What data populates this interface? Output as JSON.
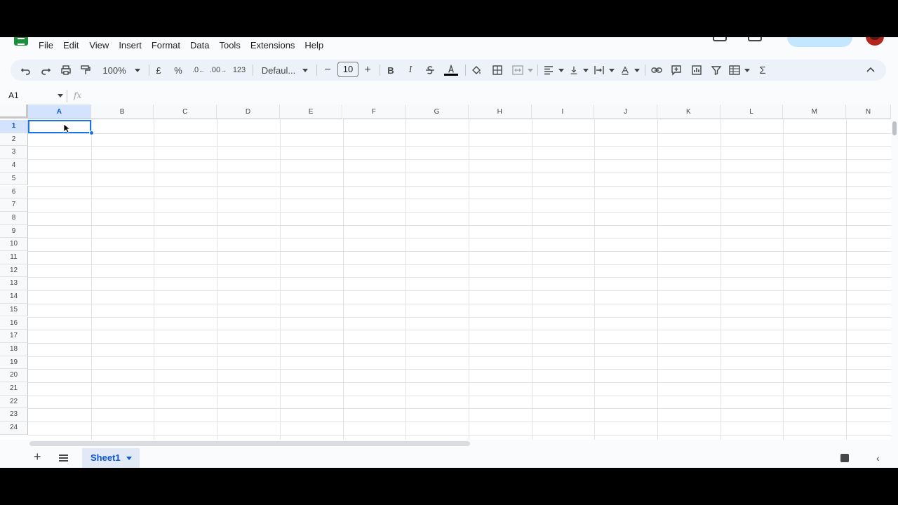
{
  "menu": [
    "File",
    "Edit",
    "View",
    "Insert",
    "Format",
    "Data",
    "Tools",
    "Extensions",
    "Help"
  ],
  "toolbar": {
    "zoom": "100%",
    "currency": "£",
    "percent": "%",
    "decrease_decimal": ".0",
    "increase_decimal": ".00",
    "number_format": "123",
    "font": "Defaul...",
    "font_size": "10",
    "minus": "−",
    "plus": "+",
    "bold": "B",
    "italic": "I",
    "sigma": "Σ"
  },
  "formula_bar": {
    "namebox": "A1",
    "fx": "fx"
  },
  "grid": {
    "columns": [
      "A",
      "B",
      "C",
      "D",
      "E",
      "F",
      "G",
      "H",
      "I",
      "J",
      "K",
      "L",
      "M",
      "N"
    ],
    "rows": [
      "1",
      "2",
      "3",
      "4",
      "5",
      "6",
      "7",
      "8",
      "9",
      "10",
      "11",
      "12",
      "13",
      "14",
      "15",
      "16",
      "17",
      "18",
      "19",
      "20",
      "21",
      "22",
      "23",
      "24"
    ],
    "active_cell": "A1"
  },
  "sheets": {
    "add": "+",
    "tab": "Sheet1"
  },
  "colors": {
    "accent": "#0b57d0",
    "selection": "#1a73e8",
    "toolbar_bg": "#edf2fa"
  }
}
